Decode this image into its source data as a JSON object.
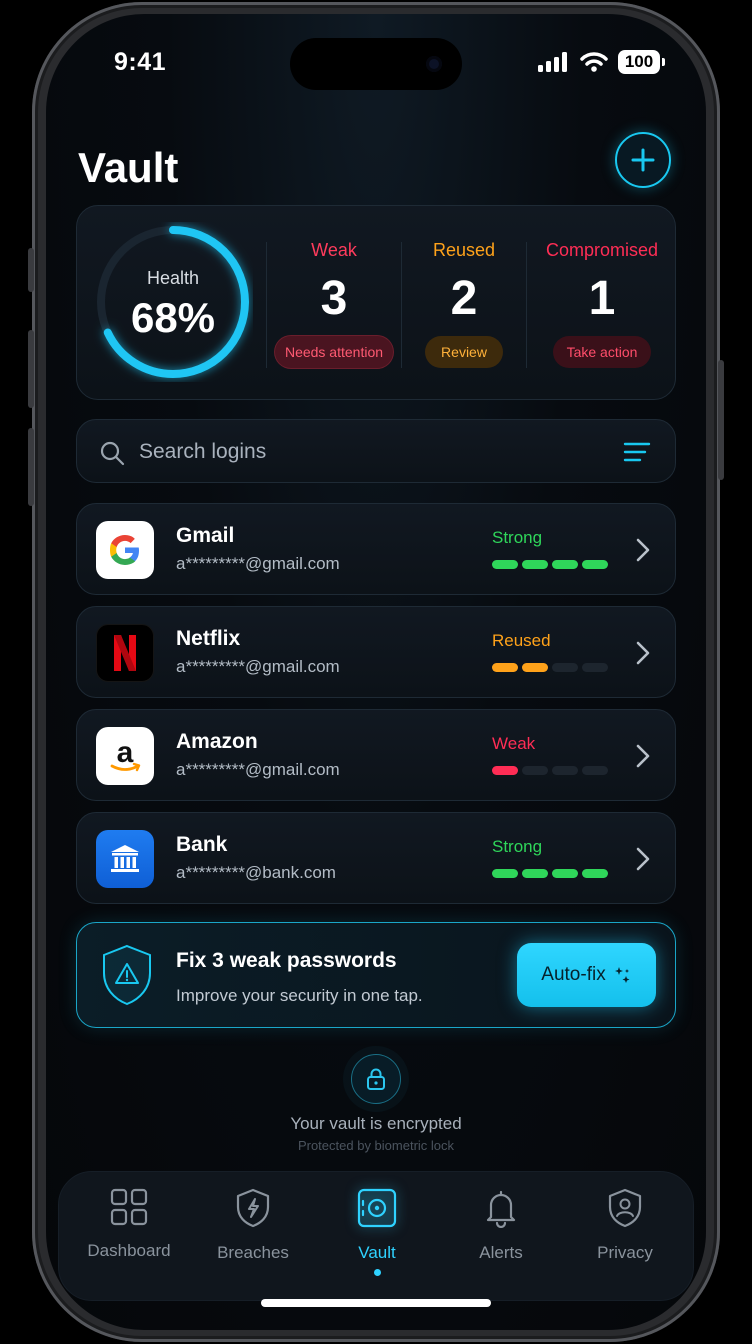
{
  "status": {
    "time": "9:41",
    "battery": "100"
  },
  "header": {
    "title": "Vault",
    "add_icon": "plus-icon"
  },
  "health": {
    "label": "Health",
    "value": "68%",
    "percent": 68,
    "stats": [
      {
        "label": "Weak",
        "value": "3",
        "pill": "Needs attention",
        "color": "#ff3b5c"
      },
      {
        "label": "Reused",
        "value": "2",
        "pill": "Review",
        "color": "#ffa21a"
      },
      {
        "label": "Compromised",
        "value": "1",
        "pill": "Take action",
        "color": "#ff2d55"
      }
    ]
  },
  "search": {
    "placeholder": "Search logins",
    "icon": "search-icon",
    "filter_icon": "filter-icon"
  },
  "logins": [
    {
      "name": "Gmail",
      "email": "a*********@gmail.com",
      "strength": "Strong",
      "level": 4,
      "color": "#2fd65a",
      "logo": "google-icon"
    },
    {
      "name": "Netflix",
      "email": "a*********@gmail.com",
      "strength": "Reused",
      "level": 2,
      "color": "#ffa21a",
      "logo": "netflix-icon"
    },
    {
      "name": "Amazon",
      "email": "a*********@gmail.com",
      "strength": "Weak",
      "level": 1,
      "color": "#ff2d55",
      "logo": "amazon-icon"
    },
    {
      "name": "Bank",
      "email": "a*********@bank.com",
      "strength": "Strong",
      "level": 4,
      "color": "#2fd65a",
      "logo": "bank-icon"
    }
  ],
  "fix": {
    "title": "Fix 3 weak passwords",
    "subtitle": "Improve your security in one tap.",
    "button": "Auto-fix"
  },
  "encryption": {
    "title": "Your vault is encrypted",
    "subtitle": "Protected by biometric lock"
  },
  "tabs": [
    {
      "label": "Dashboard",
      "icon": "dashboard-icon"
    },
    {
      "label": "Breaches",
      "icon": "breach-shield-icon"
    },
    {
      "label": "Vault",
      "icon": "vault-icon",
      "active": true
    },
    {
      "label": "Alerts",
      "icon": "bell-icon"
    },
    {
      "label": "Privacy",
      "icon": "privacy-shield-icon"
    }
  ],
  "colors": {
    "accent": "#19c8f0",
    "background": "#05070a"
  }
}
